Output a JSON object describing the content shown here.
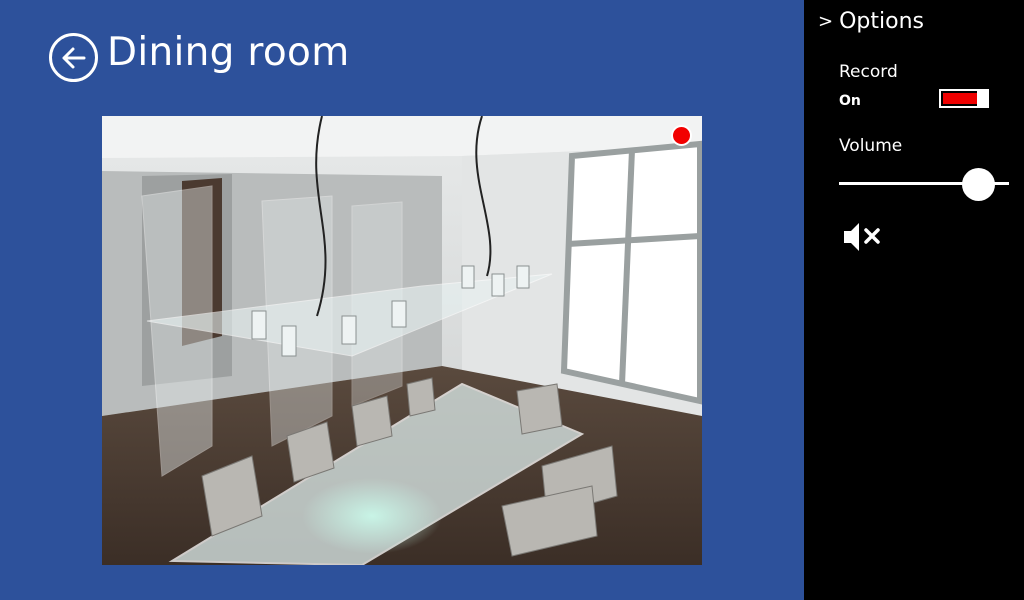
{
  "page": {
    "title": "Dining room"
  },
  "back": {
    "icon": "back-arrow-icon"
  },
  "camera": {
    "recording_indicator": "record-dot-icon",
    "indicator_color": "#f20000"
  },
  "options": {
    "title": "Options",
    "chevron_icon": "chevron-right-icon",
    "record": {
      "label": "Record",
      "state": "On",
      "enabled": true,
      "accent": "#ee0000"
    },
    "volume": {
      "label": "Volume",
      "level": 0.82
    },
    "mute": {
      "icon": "speaker-mute-icon"
    }
  },
  "colors": {
    "background": "#2d519b",
    "panel": "#000000"
  }
}
